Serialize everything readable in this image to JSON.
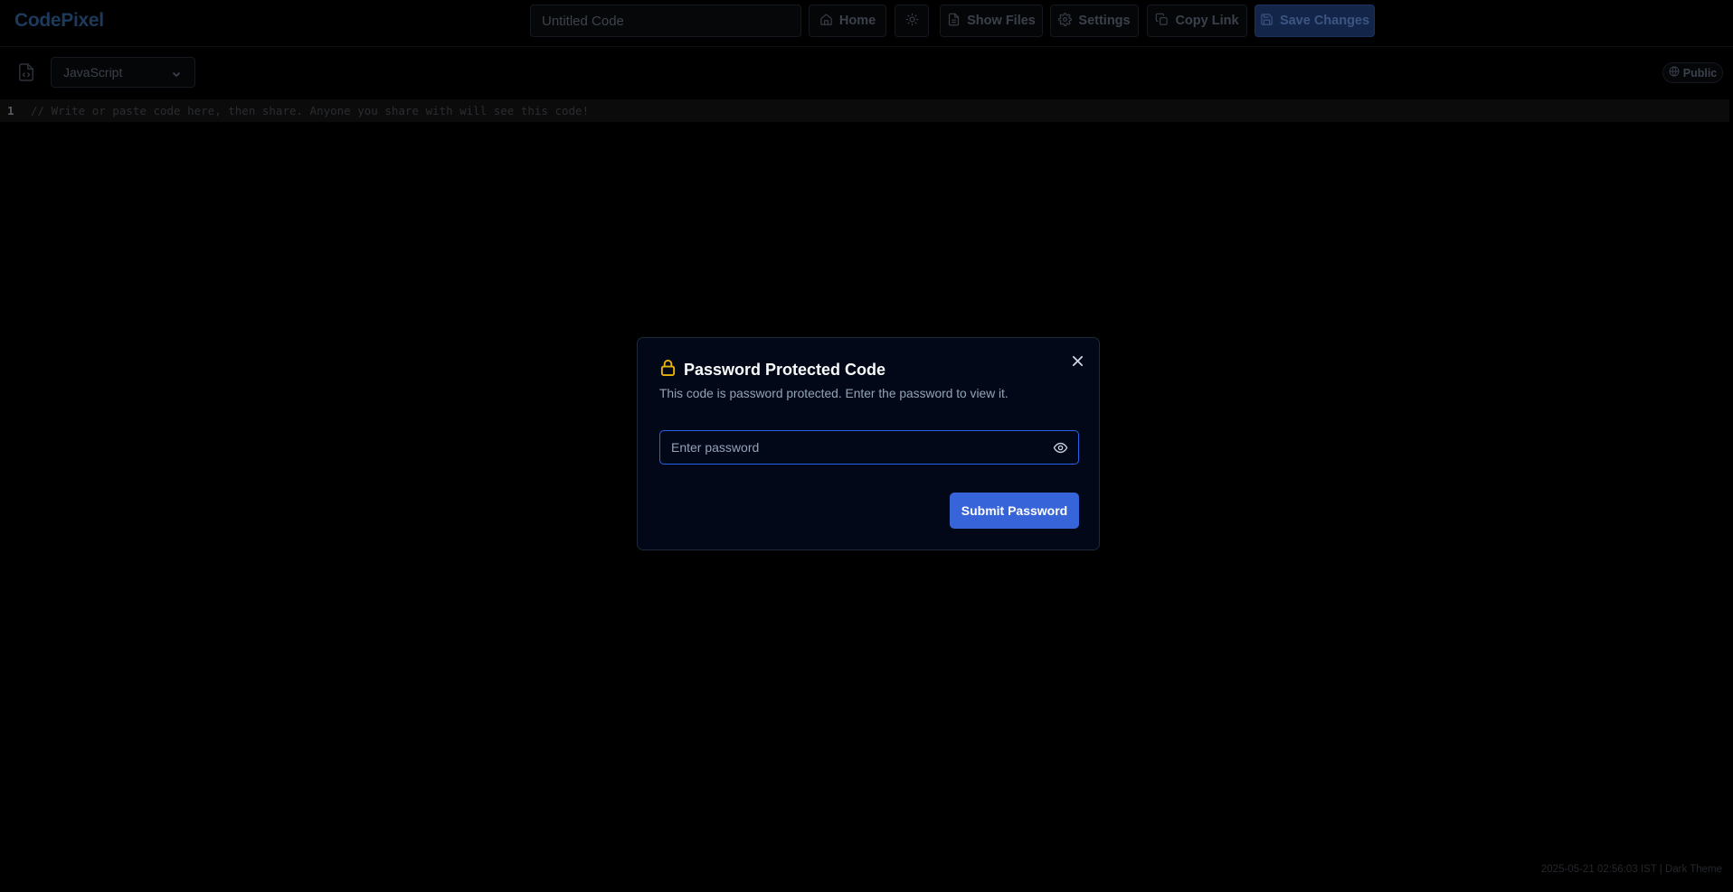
{
  "app": {
    "brand": "CodePixel"
  },
  "header": {
    "title_placeholder": "Untitled Code",
    "home_label": "Home",
    "theme_icon": "sun-icon",
    "show_files_label": "Show Files",
    "settings_label": "Settings",
    "copy_link_label": "Copy Link",
    "save_label": "Save Changes"
  },
  "toolbar": {
    "language": "JavaScript",
    "visibility": "Public"
  },
  "editor": {
    "lines": [
      {
        "number": "1",
        "code": "// Write or paste code here, then share. Anyone you share with will see this code!"
      }
    ]
  },
  "footer": {
    "status": "2025-05-21 02:56:03 IST | Dark Theme"
  },
  "modal": {
    "title": "Password Protected Code",
    "description": "This code is password protected. Enter the password to view it.",
    "password_placeholder": "Enter password",
    "submit_label": "Submit Password"
  },
  "colors": {
    "background": "#000000",
    "modal_bg": "#020817",
    "accent": "#3764d8",
    "lock": "#eab308",
    "input_focus_border": "#2563eb"
  }
}
